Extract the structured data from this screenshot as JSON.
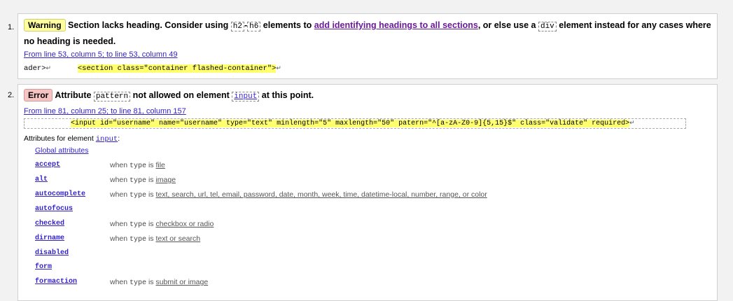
{
  "messages": [
    {
      "number": "1.",
      "badge": "Warning",
      "text_a": "Section lacks heading. Consider using ",
      "code_a": "h2",
      "dash": "-",
      "code_b": "h6",
      "text_b": " elements to ",
      "link": "add identifying headings to all sections",
      "text_c": ", or else use a ",
      "code_c": "div",
      "text_d": " element instead for any cases where no heading is needed.",
      "location": "From line 53, column 5; to line 53, column 49",
      "extract_prefix": "ader>",
      "extract_hl": "<section class=\"container flashed-container\">",
      "return_glyph": "↵"
    },
    {
      "number": "2.",
      "badge": "Error",
      "text_a": "Attribute ",
      "code_a": "pattern",
      "text_b": " not allowed on element ",
      "code_b": "input",
      "text_c": " at this point.",
      "location": "From line 81, column 25; to line 81, column 157",
      "extract_hl": "<input id=\"username\" name=\"username\" type=\"text\" minlength=\"5\" maxlength=\"50\" patern=\"^[a-zA-Z0-9]{5,15}$\" class=\"validate\" required>",
      "return_glyph": "↵",
      "attrs_intro": "Attributes for element ",
      "attrs_element": "input",
      "attrs_colon": ":",
      "attributes": [
        {
          "name": "Global attributes",
          "cond": ""
        },
        {
          "name": "accept",
          "when": "when ",
          "type": "type",
          "is": " is ",
          "vals": "file"
        },
        {
          "name": "alt",
          "when": "when ",
          "type": "type",
          "is": " is ",
          "vals": "image"
        },
        {
          "name": "autocomplete",
          "when": "when ",
          "type": "type",
          "is": " is ",
          "vals": "text, search, url, tel, email, password, date, month, week, time, datetime-local, number, range, or color"
        },
        {
          "name": "autofocus",
          "cond": ""
        },
        {
          "name": "checked",
          "when": "when ",
          "type": "type",
          "is": " is ",
          "vals": "checkbox or radio"
        },
        {
          "name": "dirname",
          "when": "when ",
          "type": "type",
          "is": " is ",
          "vals": "text or search"
        },
        {
          "name": "disabled",
          "cond": ""
        },
        {
          "name": "form",
          "cond": ""
        },
        {
          "name": "formaction",
          "when": "when ",
          "type": "type",
          "is": " is ",
          "vals": "submit or image"
        }
      ]
    }
  ]
}
